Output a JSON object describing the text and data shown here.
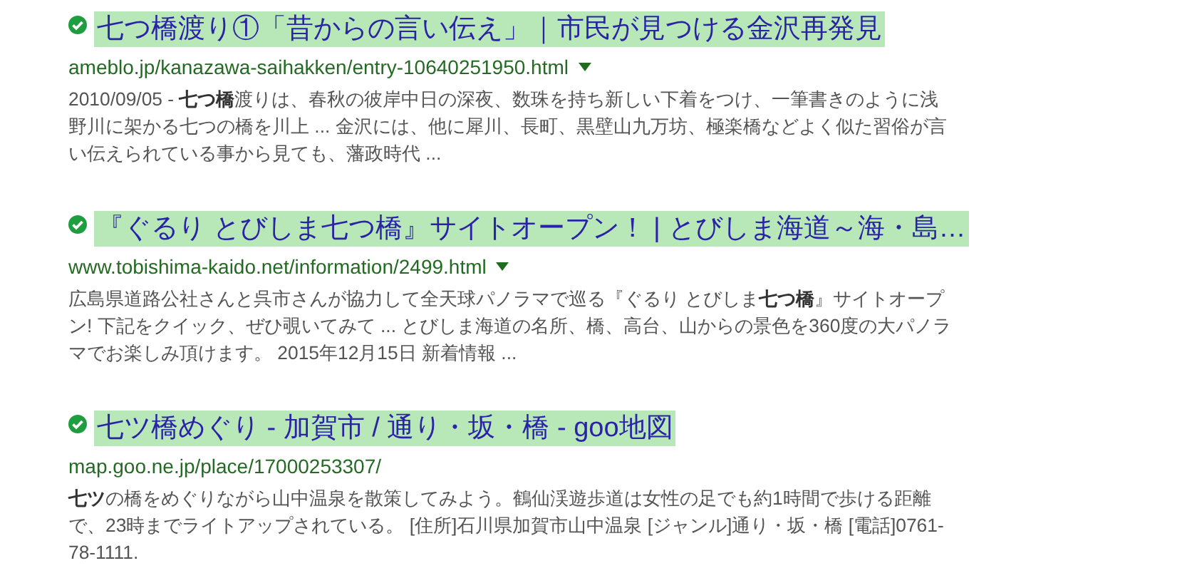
{
  "results": [
    {
      "verified": true,
      "title": "七つ橋渡り①「昔からの言い伝え」｜市民が見つける金沢再発見",
      "url": "ameblo.jp/kanazawa-saihakken/entry-10640251950.html",
      "menu_caret": true,
      "snippet": "2010/09/05 - **七つ橋**渡りは、春秋の彼岸中日の深夜、数珠を持ち新しい下着をつけ、一筆書きのように浅野川に架かる七つの橋を川上 ... 金沢には、他に犀川、長町、黒壁山九万坊、極楽橋などよく似た習俗が言い伝えられている事から見ても、藩政時代 ..."
    },
    {
      "verified": true,
      "title": "『ぐるり とびしま七つ橋』サイトオープン！ | とびしま海道～海・島…",
      "url": "www.tobishima-kaido.net/information/2499.html",
      "menu_caret": true,
      "snippet": "広島県道路公社さんと呉市さんが協力して全天球パノラマで巡る『ぐるり とびしま**七つ橋**』サイトオープン! 下記をクイック、ぜひ覗いてみて ... とびしま海道の名所、橋、高台、山からの景色を360度の大パノラマでお楽しみ頂けます。 2015年12月15日 新着情報 ..."
    },
    {
      "verified": true,
      "title": "七ツ橋めぐり - 加賀市 / 通り・坂・橋 - goo地図",
      "url": "map.goo.ne.jp/place/17000253307/",
      "menu_caret": false,
      "snippet": "**七ツ**の橋をめぐりながら山中温泉を散策してみよう。鶴仙渓遊歩道は女性の足でも約1時間で歩ける距離で、23時までライトアップされている。 [住所]石川県加賀市山中温泉 [ジャンル]通り・坂・橋 [電話]0761-78-1111."
    }
  ]
}
